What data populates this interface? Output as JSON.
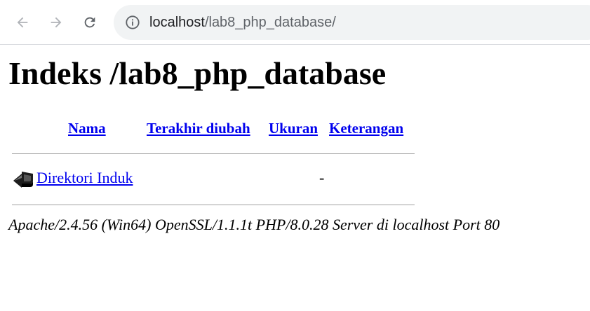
{
  "browser": {
    "url_host": "localhost",
    "url_path": "/lab8_php_database/"
  },
  "page": {
    "title": "Indeks /lab8_php_database",
    "columns": {
      "name": "Nama",
      "modified": "Terakhir diubah",
      "size": "Ukuran",
      "description": "Keterangan"
    },
    "rows": [
      {
        "name": "Direktori Induk",
        "modified": "",
        "size": "-",
        "description": "",
        "icon": "back-icon"
      }
    ],
    "footer": "Apache/2.4.56 (Win64) OpenSSL/1.1.1t PHP/8.0.28 Server di localhost Port 80"
  },
  "colors": {
    "link": "#0000ee",
    "omnibox_bg": "#f1f3f4",
    "rule": "#a0a0a0"
  }
}
